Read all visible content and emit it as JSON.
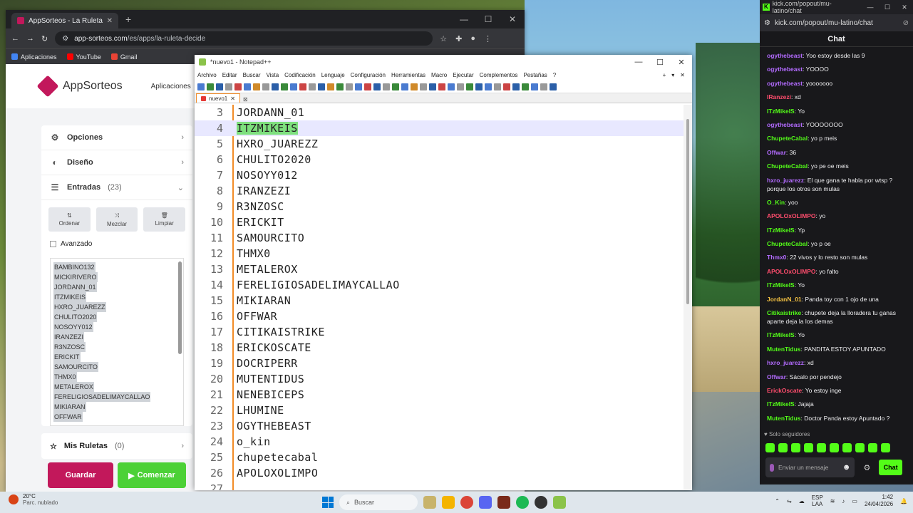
{
  "browser": {
    "tab_title": "AppSorteos - La Ruleta de la Su...",
    "url_domain": "app-sorteos.com",
    "url_path": "/es/apps/la-ruleta-decide",
    "bookmarks": [
      "Aplicaciones",
      "YouTube",
      "Gmail"
    ]
  },
  "appsorteos": {
    "brand": "AppSorteos",
    "apps_menu": "Aplicaciones",
    "menu": {
      "opciones": "Opciones",
      "diseno": "Diseño",
      "entradas": "Entradas",
      "entradas_count": "(23)"
    },
    "tools": [
      "Ordenar",
      "Mezclar",
      "Limpiar"
    ],
    "advanced_label": "Avanzado",
    "entries": [
      "BAMBINO132",
      "MICKIRIVERO",
      "JORDANN_01",
      "ITZMIKEIS",
      "HXRO_JUAREZZ",
      "CHULITO2020",
      "NOSOYY012",
      "IRANZEZI",
      "R3NZOSC",
      "ERICKIT",
      "SAMOURCITO",
      "THMX0",
      "METALEROX",
      "FERELIGIOSADELIMAYCALLAO",
      "MIKIARAN",
      "OFFWAR"
    ],
    "mis_ruletas": "Mis Ruletas",
    "mis_ruletas_count": "(0)",
    "save_label": "Guardar",
    "start_label": "Comenzar"
  },
  "notepad": {
    "title": "*nuevo1 - Notepad++",
    "menu": [
      "Archivo",
      "Editar",
      "Buscar",
      "Vista",
      "Codificación",
      "Lenguaje",
      "Configuración",
      "Herramientas",
      "Macro",
      "Ejecutar",
      "Complementos",
      "Pestañas",
      "?"
    ],
    "tab": "nuevo1",
    "lines": [
      {
        "n": "3",
        "t": "JORDANN_01"
      },
      {
        "n": "4",
        "t": "ITZMIKEIS"
      },
      {
        "n": "5",
        "t": "HXRO_JUAREZZ"
      },
      {
        "n": "6",
        "t": "CHULITO2020"
      },
      {
        "n": "7",
        "t": "NOSOYY012"
      },
      {
        "n": "8",
        "t": "IRANZEZI"
      },
      {
        "n": "9",
        "t": "R3NZOSC"
      },
      {
        "n": "10",
        "t": "ERICKIT"
      },
      {
        "n": "11",
        "t": "SAMOURCITO"
      },
      {
        "n": "12",
        "t": "THMX0"
      },
      {
        "n": "13",
        "t": "METALEROX"
      },
      {
        "n": "14",
        "t": "FERELIGIOSADELIMAYCALLAO"
      },
      {
        "n": "15",
        "t": "MIKIARAN"
      },
      {
        "n": "16",
        "t": "OFFWAR"
      },
      {
        "n": "17",
        "t": "CITIKAISTRIKE"
      },
      {
        "n": "18",
        "t": "ERICKOSCATE"
      },
      {
        "n": "19",
        "t": "DOCRIPERR"
      },
      {
        "n": "20",
        "t": "MUTENTIDUS"
      },
      {
        "n": "21",
        "t": "NENEBICEPS"
      },
      {
        "n": "22",
        "t": "LHUMINE"
      },
      {
        "n": "23",
        "t": "OGYTHEBEAST"
      },
      {
        "n": "24",
        "t": "o_kin"
      },
      {
        "n": "25",
        "t": "chupetecabal"
      },
      {
        "n": "26",
        "t": "APOLOXOLIMPO"
      },
      {
        "n": "27",
        "t": ""
      }
    ]
  },
  "kick": {
    "window_title": "kick.com/popout/mu-latino/chat",
    "url": "kick.com/popout/mu-latino/chat",
    "header": "Chat",
    "messages": [
      {
        "u": "ogythebeast",
        "c": "#b36bff",
        "m": "Yoo estoy desde las 9"
      },
      {
        "u": "ogythebeast",
        "c": "#b36bff",
        "m": "YOOOO"
      },
      {
        "u": "ogythebeast",
        "c": "#b36bff",
        "m": "yooooooo"
      },
      {
        "u": "IRanzezi",
        "c": "#ff4d6d",
        "m": "xd"
      },
      {
        "u": "ITzMikeIS",
        "c": "#53fc18",
        "m": "Yo"
      },
      {
        "u": "ogythebeast",
        "c": "#b36bff",
        "m": "YOOOOOOO"
      },
      {
        "u": "ChupeteCabal",
        "c": "#53fc18",
        "m": "yo p meis"
      },
      {
        "u": "Offwar",
        "c": "#b36bff",
        "m": "36"
      },
      {
        "u": "ChupeteCabal",
        "c": "#53fc18",
        "m": "yo pe oe meis"
      },
      {
        "u": "hxro_juarezz",
        "c": "#b36bff",
        "m": "El que gana te habla por wtsp ? porque los otros son mulas"
      },
      {
        "u": "O_Kin",
        "c": "#53fc18",
        "m": "yoo"
      },
      {
        "u": "APOLOxOLIMPO",
        "c": "#ff4d6d",
        "m": "yo"
      },
      {
        "u": "ITzMikeIS",
        "c": "#53fc18",
        "m": "Yp"
      },
      {
        "u": "ChupeteCabal",
        "c": "#53fc18",
        "m": "yo p oe"
      },
      {
        "u": "Thmx0",
        "c": "#b36bff",
        "m": "22 vivos y lo resto son mulas"
      },
      {
        "u": "APOLOxOLIMPO",
        "c": "#ff4d6d",
        "m": "yo falto"
      },
      {
        "u": "ITzMikeIS",
        "c": "#53fc18",
        "m": "Yo"
      },
      {
        "u": "JordanN_01",
        "c": "#f5c242",
        "m": "Panda toy con 1 ojo de una"
      },
      {
        "u": "Citikaistrike",
        "c": "#53fc18",
        "m": "chupete deja la lloradera tu ganas aparte deja la los demas"
      },
      {
        "u": "ITzMikeIS",
        "c": "#53fc18",
        "m": "Yo"
      },
      {
        "u": "MutenTidus",
        "c": "#53fc18",
        "m": "PANDITA ESTOY APUNTADO"
      },
      {
        "u": "hxro_juarezz",
        "c": "#b36bff",
        "m": "xd"
      },
      {
        "u": "Offwar",
        "c": "#b36bff",
        "m": "Sácalo por pendejo"
      },
      {
        "u": "ErickOscate",
        "c": "#ff4d6d",
        "m": "Yo estoy inge"
      },
      {
        "u": "ITzMikeIS",
        "c": "#53fc18",
        "m": "Jajaja"
      },
      {
        "u": "MutenTidus",
        "c": "#53fc18",
        "m": "Doctor Panda estoy Apuntado ?"
      }
    ],
    "followers_only": "Solo seguidores",
    "input_placeholder": "Enviar un mensaje",
    "send_label": "Chat"
  },
  "taskbar": {
    "temp": "20°C",
    "weather": "Parc. nublado",
    "search": "Buscar",
    "lang": "ESP",
    "lang2": "LAA",
    "time": "1:42",
    "date": "24/04/2026"
  }
}
